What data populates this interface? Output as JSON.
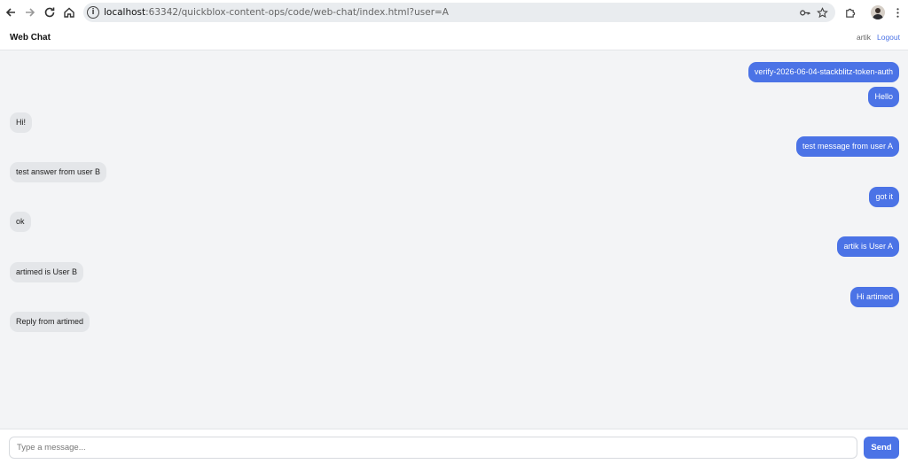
{
  "browser": {
    "url_host": "localhost",
    "url_rest": ":63342/quickblox-content-ops/code/web-chat/index.html?user=A"
  },
  "app": {
    "title": "Web Chat",
    "user": "artik",
    "logout_label": "Logout"
  },
  "messages": [
    {
      "direction": "out",
      "text": "verify-2026-06-04-stackblitz-token-auth"
    },
    {
      "direction": "out",
      "text": "Hello"
    },
    {
      "direction": "in",
      "text": "Hi!"
    },
    {
      "direction": "out",
      "text": "test message from user A"
    },
    {
      "direction": "in",
      "text": "test answer from user B"
    },
    {
      "direction": "out",
      "text": "got it"
    },
    {
      "direction": "in",
      "text": "ok"
    },
    {
      "direction": "out",
      "text": "artik is User A"
    },
    {
      "direction": "in",
      "text": "artimed is User B"
    },
    {
      "direction": "out",
      "text": "Hi artimed"
    },
    {
      "direction": "in",
      "text": "Reply from artimed"
    }
  ],
  "composer": {
    "placeholder": "Type a message...",
    "send_label": "Send"
  },
  "colors": {
    "accent": "#4b73e6",
    "incoming_bubble": "#e4e6e9",
    "messages_bg": "#f3f4f6"
  }
}
